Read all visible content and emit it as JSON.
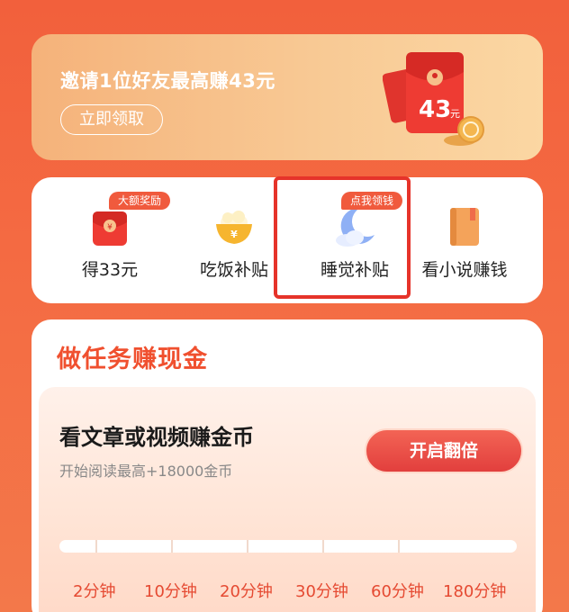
{
  "banner": {
    "title": "邀请1位好友最高赚43元",
    "button_label": "立即领取",
    "envelope_amount": "43",
    "envelope_unit": "元"
  },
  "quick_actions": [
    {
      "label": "得33元",
      "tag": "大额奖励",
      "icon": "red-envelope-icon"
    },
    {
      "label": "吃饭补贴",
      "tag": "",
      "icon": "rice-bowl-icon"
    },
    {
      "label": "睡觉补贴",
      "tag": "点我领钱",
      "icon": "moon-cloud-icon"
    },
    {
      "label": "看小说赚钱",
      "tag": "",
      "icon": "book-icon"
    }
  ],
  "tasks": {
    "section_title": "做任务赚现金",
    "card": {
      "title": "看文章或视频赚金币",
      "subtitle": "开始阅读最高+18000金币",
      "button_label": "开启翻倍",
      "times": [
        "2分钟",
        "10分钟",
        "20分钟",
        "30分钟",
        "60分钟",
        "180分钟"
      ]
    }
  },
  "colors": {
    "accent": "#f05a3d",
    "highlight": "#e6332a",
    "section_title": "#f0502f"
  }
}
